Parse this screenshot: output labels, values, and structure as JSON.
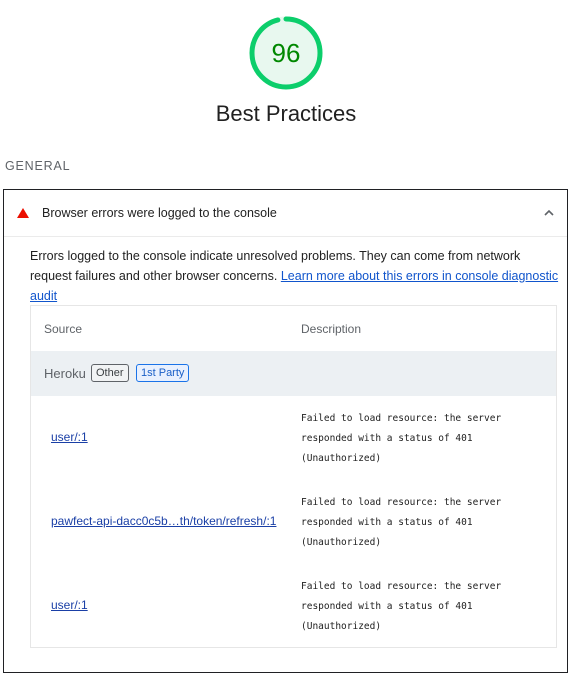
{
  "category": {
    "score": "96",
    "score_fraction": 0.96,
    "title": "Best Practices",
    "score_color": "#0cce6b"
  },
  "group": {
    "label": "GENERAL"
  },
  "audit": {
    "title": "Browser errors were logged to the console",
    "status_icon": "warning-triangle-icon",
    "status_color": "#eb0f00",
    "description": "Errors logged to the console indicate unresolved problems. They can come from network request failures and other browser concerns.",
    "learn_more_link": "Learn more about this errors in console diagnostic audit",
    "table": {
      "headers": {
        "source": "Source",
        "description": "Description"
      },
      "entity": {
        "name": "Heroku",
        "tag_other": "Other",
        "tag_party": "1st Party"
      },
      "rows": [
        {
          "source": "user/:1",
          "description": "Failed to load resource: the server responded with a status of 401 (Unauthorized)"
        },
        {
          "source": "pawfect-api-dacc0c5b…th/token/refresh/:1",
          "description": "Failed to load resource: the server responded with a status of 401 (Unauthorized)"
        },
        {
          "source": "user/:1",
          "description": "Failed to load resource: the server responded with a status of 401 (Unauthorized)"
        }
      ]
    }
  }
}
